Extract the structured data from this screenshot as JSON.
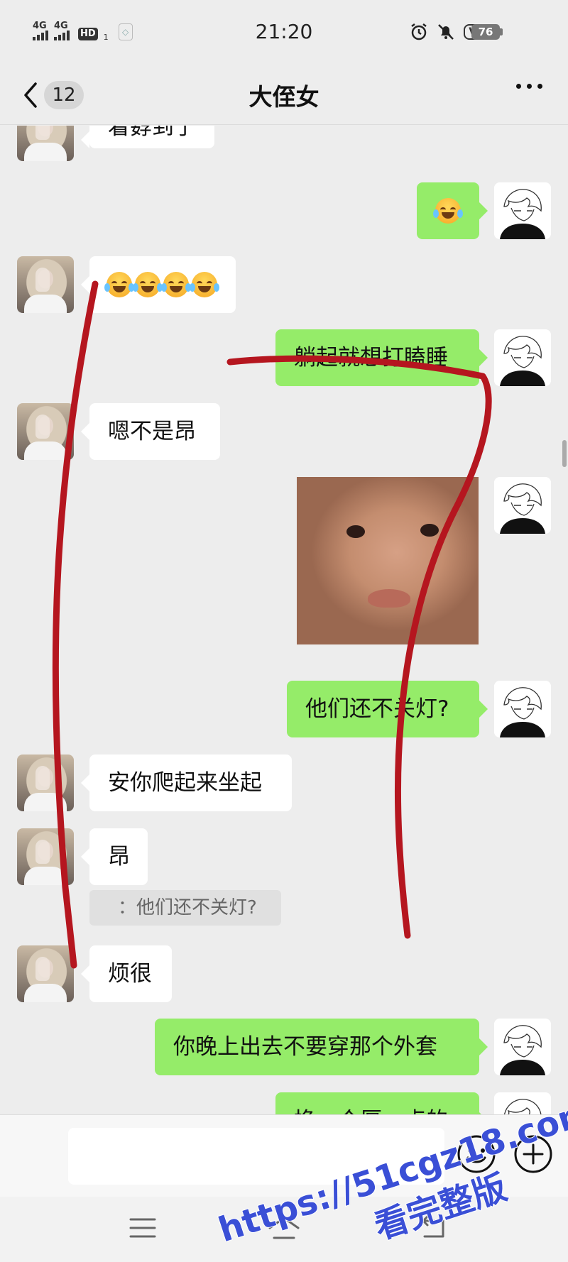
{
  "status_bar": {
    "time": "21:20",
    "signal_1": "4G",
    "signal_2": "4G",
    "hd_label": "HD",
    "hd_sub": "1",
    "vpn_label": "VPN",
    "battery": "76",
    "icons": [
      "alarm-icon",
      "mute-bell-icon",
      "eth-icon"
    ]
  },
  "nav": {
    "title": "大侄女",
    "unread_count": "12",
    "back_icon": "chevron-left-icon",
    "more_icon": "more-dots-icon"
  },
  "messages": [
    {
      "from": "them",
      "type": "text",
      "text": "着孬到了"
    },
    {
      "from": "me",
      "type": "emoji",
      "text": "😭"
    },
    {
      "from": "them",
      "type": "emoji",
      "text": "😂😂😂😂"
    },
    {
      "from": "me",
      "type": "text",
      "text": "躺起就想打瞌睡"
    },
    {
      "from": "them",
      "type": "text",
      "text": "嗯不是昂"
    },
    {
      "from": "me",
      "type": "image",
      "text": ""
    },
    {
      "from": "me",
      "type": "text",
      "text": "他们还不关灯?"
    },
    {
      "from": "them",
      "type": "text",
      "text": "安你爬起来坐起"
    },
    {
      "from": "them",
      "type": "text",
      "text": "昂",
      "quote": "：他们还不关灯?"
    },
    {
      "from": "them",
      "type": "text",
      "text": "烦很"
    },
    {
      "from": "me",
      "type": "text",
      "text": "你晚上出去不要穿那个外套"
    },
    {
      "from": "me",
      "type": "text",
      "text": "换一个厚一点的"
    }
  ],
  "input_bar": {
    "placeholder": "",
    "emoji_icon": "smile-icon",
    "plus_icon": "plus-circle-icon"
  },
  "system_nav": {
    "icons": [
      "menu-icon",
      "home-icon",
      "back-icon"
    ]
  },
  "watermark": {
    "line1": "https://51cgz18.com",
    "line2": "看完整版"
  },
  "colors": {
    "background": "#ededed",
    "my_bubble": "#95ec69",
    "their_bubble": "#ffffff",
    "scribble": "#b5161f",
    "watermark": "#3a4fd6"
  }
}
